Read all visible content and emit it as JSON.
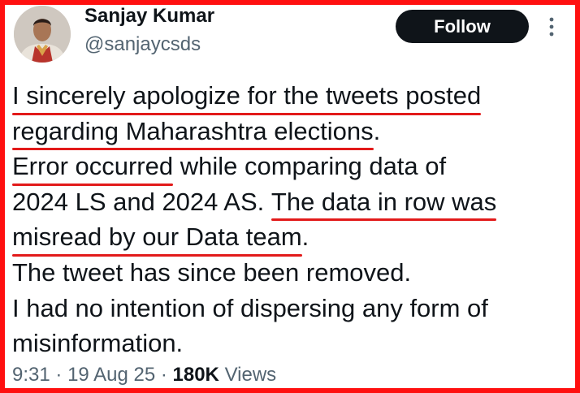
{
  "author": {
    "name": "Sanjay Kumar",
    "handle": "@sanjaycsds"
  },
  "actions": {
    "follow_label": "Follow",
    "more_icon": "more-vertical-icon"
  },
  "tweet": {
    "lines": [
      {
        "pre": "",
        "ul": "I sincerely apologize for the tweets posted",
        "post": ""
      },
      {
        "pre": "",
        "ul": "regarding Maharashtra elections",
        "post": "."
      },
      {
        "pre": "",
        "ul": "Error occurred",
        "post": " while comparing data of"
      },
      {
        "pre": "2024 LS and 2024 AS. ",
        "ul": "The data in row was",
        "post": ""
      },
      {
        "pre": "",
        "ul": "misread by our Data team",
        "post": "."
      },
      {
        "pre": "The tweet has since been removed.",
        "ul": "",
        "post": ""
      },
      {
        "pre": "I had no intention of dispersing any form of",
        "ul": "",
        "post": ""
      },
      {
        "pre": "misinformation.",
        "ul": "",
        "post": ""
      }
    ]
  },
  "meta": {
    "time": "9:31",
    "date": "19 Aug 25",
    "views_count": "180K",
    "views_label": "Views",
    "separator": "·"
  },
  "colors": {
    "frame": "#ff1010",
    "underline": "#e21a1a",
    "text": "#0f1419",
    "secondary": "#536471",
    "button": "#0f1419"
  }
}
